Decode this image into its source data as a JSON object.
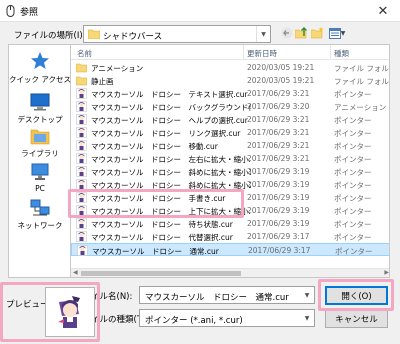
{
  "window": {
    "title": "参照"
  },
  "location": {
    "label": "ファイルの場所(I):",
    "value": "シャドウバース"
  },
  "places": [
    {
      "label": "クイック アクセス",
      "icon": "star-icon"
    },
    {
      "label": "デスクトップ",
      "icon": "desktop-icon"
    },
    {
      "label": "ライブラリ",
      "icon": "library-icon"
    },
    {
      "label": "PC",
      "icon": "pc-icon"
    },
    {
      "label": "ネットワーク",
      "icon": "network-icon"
    }
  ],
  "columns": {
    "name": "名前",
    "date": "更新日時",
    "type": "種類"
  },
  "files": [
    {
      "name": "アニメーション",
      "date": "2020/03/05 19:21",
      "type": "ファイル フォルダー",
      "kind": "folder"
    },
    {
      "name": "静止画",
      "date": "2020/03/05 19:21",
      "type": "ファイル フォルダー",
      "kind": "folder"
    },
    {
      "name": "マウスカーソル　ドロシー　テキスト選択.cur",
      "date": "2017/06/29 3:21",
      "type": "ポインター",
      "kind": "cursor"
    },
    {
      "name": "マウスカーソル　ドロシー　バックグラウンド作業中.ani",
      "date": "2017/06/29 3:20",
      "type": "アニメーション ポインター",
      "kind": "cursor"
    },
    {
      "name": "マウスカーソル　ドロシー　ヘルプの選択.cur",
      "date": "2017/06/29 3:21",
      "type": "ポインター",
      "kind": "cursor"
    },
    {
      "name": "マウスカーソル　ドロシー　リンク選択.cur",
      "date": "2017/06/29 3:21",
      "type": "ポインター",
      "kind": "cursor"
    },
    {
      "name": "マウスカーソル　ドロシー　移動.cur",
      "date": "2017/06/29 3:21",
      "type": "ポインター",
      "kind": "cursor"
    },
    {
      "name": "マウスカーソル　ドロシー　左右に拡大・縮小.cur",
      "date": "2017/06/29 3:21",
      "type": "ポインター",
      "kind": "cursor"
    },
    {
      "name": "マウスカーソル　ドロシー　斜めに拡大・縮小1.cur",
      "date": "2017/06/29 3:19",
      "type": "ポインター",
      "kind": "cursor"
    },
    {
      "name": "マウスカーソル　ドロシー　斜めに拡大・縮小2.cur",
      "date": "2017/06/29 3:19",
      "type": "ポインター",
      "kind": "cursor"
    },
    {
      "name": "マウスカーソル　ドロシー　手書き.cur",
      "date": "2017/06/29 3:19",
      "type": "ポインター",
      "kind": "cursor"
    },
    {
      "name": "マウスカーソル　ドロシー　上下に拡大・縮小.cur",
      "date": "2017/06/29 3:19",
      "type": "ポインター",
      "kind": "cursor"
    },
    {
      "name": "マウスカーソル　ドロシー　待ち状態.cur",
      "date": "2017/06/29 3:19",
      "type": "ポインター",
      "kind": "cursor"
    },
    {
      "name": "マウスカーソル　ドロシー　代替選択.cur",
      "date": "2017/06/29 3:17",
      "type": "ポインター",
      "kind": "cursor"
    },
    {
      "name": "マウスカーソル　ドロシー　通常.cur",
      "date": "2017/06/29 3:17",
      "type": "ポインター",
      "kind": "cursor",
      "selected": true
    }
  ],
  "filename": {
    "label": "ファイル名(N):",
    "value": "マウスカーソル　ドロシー　通常.cur"
  },
  "filetype": {
    "label": "ファイルの種類(T):",
    "value": "ポインター (*.ani, *.cur)"
  },
  "buttons": {
    "open": "開く(O)",
    "cancel": "キャンセル"
  },
  "preview": {
    "label": "プレビュー:"
  },
  "colors": {
    "accent": "#0078d7",
    "selection": "#cce8ff",
    "highlight": "#f4a7c3",
    "folder": "#f8d775"
  }
}
